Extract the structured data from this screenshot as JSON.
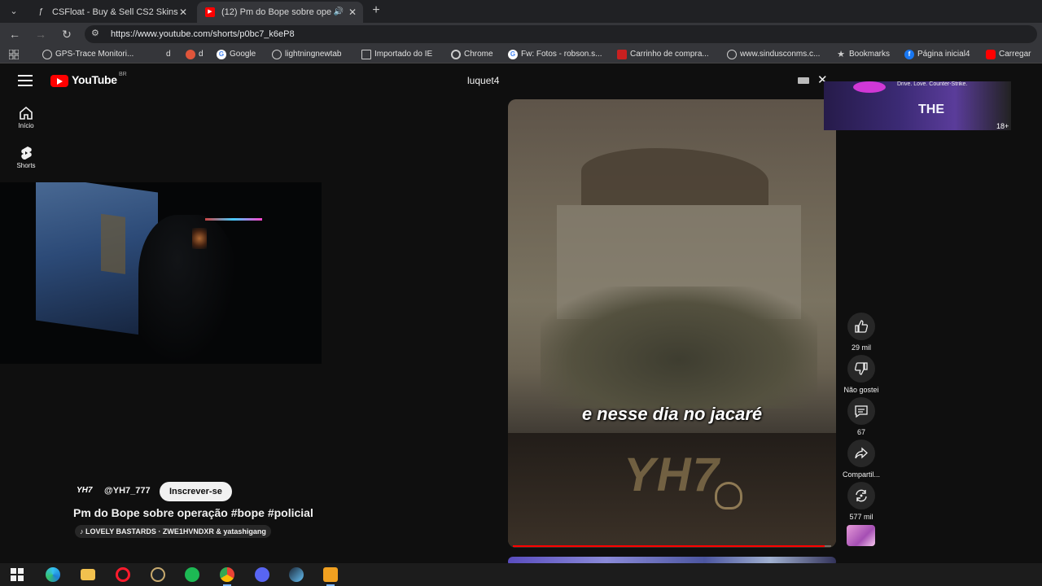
{
  "browser": {
    "tabs": [
      {
        "title": "CSFloat - Buy & Sell CS2 Skins",
        "active": false,
        "favicon": "csfloat-icon"
      },
      {
        "title": "(12) Pm do Bope sobre ope",
        "active": true,
        "favicon": "youtube-icon"
      }
    ],
    "url": "https://www.youtube.com/shorts/p0bc7_k6eP8",
    "bookmarks": [
      {
        "label": "GPS-Trace Monitori...",
        "icon": "globe-icon"
      },
      {
        "label": "d",
        "icon": "none"
      },
      {
        "label": "d",
        "icon": "mascot-icon"
      },
      {
        "label": "Google",
        "icon": "google-icon"
      },
      {
        "label": "lightningnewtab",
        "icon": "globe-icon"
      },
      {
        "label": "Importado do IE",
        "icon": "folder-icon"
      },
      {
        "label": "Chrome",
        "icon": "chrome-icon"
      },
      {
        "label": "Fw: Fotos - robson.s...",
        "icon": "google-icon"
      },
      {
        "label": "Carrinho de compra...",
        "icon": "store-icon"
      },
      {
        "label": "www.sindusconms.c...",
        "icon": "globe-icon"
      },
      {
        "label": "Bookmarks",
        "icon": "star-icon"
      },
      {
        "label": "Página inicial4",
        "icon": "facebook-icon"
      },
      {
        "label": "Carregar",
        "icon": "youtube-icon"
      }
    ]
  },
  "youtube": {
    "logo_text": "YouTube",
    "country": "BR",
    "search_query": "luquet4",
    "sidebar": [
      {
        "label": "Início",
        "icon": "home-icon"
      },
      {
        "label": "Shorts",
        "icon": "shorts-icon"
      }
    ],
    "short": {
      "channel_logo": "YH7",
      "channel_handle": "@YH7_777",
      "subscribe_label": "Inscrever-se",
      "title": "Pm do Bope sobre operação #bope #policial",
      "music": "LOVELY BASTARDS · ZWE1HVNDXR & yatashigang",
      "caption": "e nesse dia no jacaré",
      "watermark": "YH7",
      "progress": 0.98
    },
    "actions": [
      {
        "label": "29 mil",
        "icon": "like-icon"
      },
      {
        "label": "Não gostei",
        "icon": "dislike-icon"
      },
      {
        "label": "67",
        "icon": "comment-icon"
      },
      {
        "label": "Compartil...",
        "icon": "share-icon"
      },
      {
        "label": "577 mil",
        "icon": "remix-icon"
      }
    ],
    "ad": {
      "top_text": "Drive. Love. Counter-Strike.",
      "brand": "THE",
      "rating": "18+"
    }
  },
  "taskbar": {
    "apps": [
      "windows-start-icon",
      "edge-icon",
      "file-explorer-icon",
      "opera-icon",
      "lol-client-icon",
      "spotify-icon",
      "chrome-icon",
      "discord-icon",
      "steam-icon",
      "cs2-icon"
    ]
  },
  "colors": {
    "yt_red": "#ff0000",
    "page_bg": "#0f0f0f",
    "chrome_tab_bg": "#202124",
    "chrome_toolbar": "#35363a"
  }
}
